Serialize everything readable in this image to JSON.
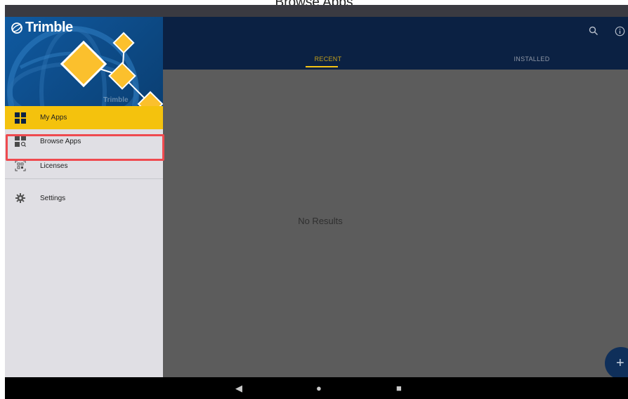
{
  "caption": "Browse Apps",
  "app": {
    "brand": "Trimble",
    "watermark": "Trimble"
  },
  "toolbar": {
    "search_icon": "search-icon",
    "info_icon": "info-icon"
  },
  "tabs": [
    {
      "label": "RECENT",
      "active": true
    },
    {
      "label": "INSTALLED",
      "active": false
    }
  ],
  "drawer": {
    "items": [
      {
        "label": "My Apps",
        "icon": "grid-icon",
        "selected": true
      },
      {
        "label": "Browse Apps",
        "icon": "browse-grid-search-icon",
        "selected": false,
        "highlighted": true
      },
      {
        "label": "Licenses",
        "icon": "qr-code-icon",
        "selected": false
      },
      {
        "label": "Settings",
        "icon": "gear-icon",
        "selected": false
      }
    ]
  },
  "main": {
    "empty_text": "No Results"
  },
  "fab": {
    "icon": "plus-icon",
    "label": "+"
  },
  "system_nav": {
    "back": "◀",
    "home": "●",
    "recents": "■"
  },
  "colors": {
    "app_bar": "#0b2143",
    "accent_yellow": "#f4c20d",
    "highlight_red": "#ef4a4f",
    "drawer_bg": "#e0dfe4",
    "scrim": "#5c5c5c"
  }
}
